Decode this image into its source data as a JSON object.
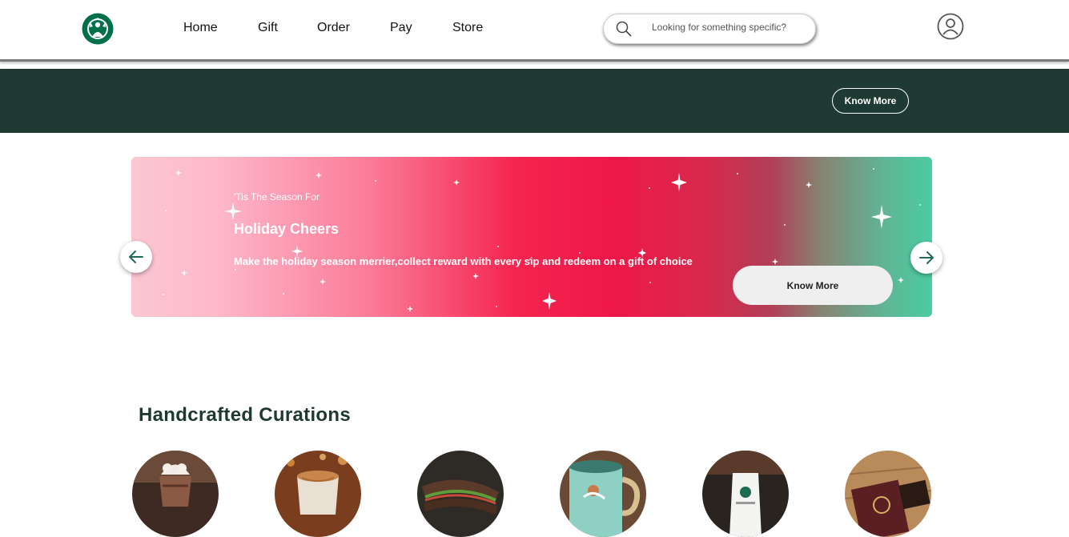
{
  "header": {
    "logo": "starbucks-siren-logo",
    "nav": [
      {
        "label": "Home"
      },
      {
        "label": "Gift"
      },
      {
        "label": "Order"
      },
      {
        "label": "Pay"
      },
      {
        "label": "Store"
      }
    ],
    "search": {
      "placeholder": "Looking for something specific?",
      "icon": "search-icon"
    },
    "profile_icon": "user-circle-icon"
  },
  "band": {
    "button_label": "Know More"
  },
  "hero": {
    "kicker": "'Tis The Season For",
    "title": "Holiday Cheers",
    "text": "Make the holiday season merrier,collect reward with every sip and redeem on a gift of choice",
    "button_label": "Know More",
    "prev_icon": "arrow-left-icon",
    "next_icon": "arrow-right-icon"
  },
  "curations": {
    "title": "Handcrafted Curations",
    "items": [
      {
        "icon": "frappuccino-image"
      },
      {
        "icon": "latte-image"
      },
      {
        "icon": "sandwich-image"
      },
      {
        "icon": "mug-image"
      },
      {
        "icon": "coffee-bag-image"
      },
      {
        "icon": "gift-box-image"
      }
    ]
  },
  "colors": {
    "brand_green": "#1e3932",
    "band": "#1f3933",
    "accent_green": "#00704a"
  }
}
